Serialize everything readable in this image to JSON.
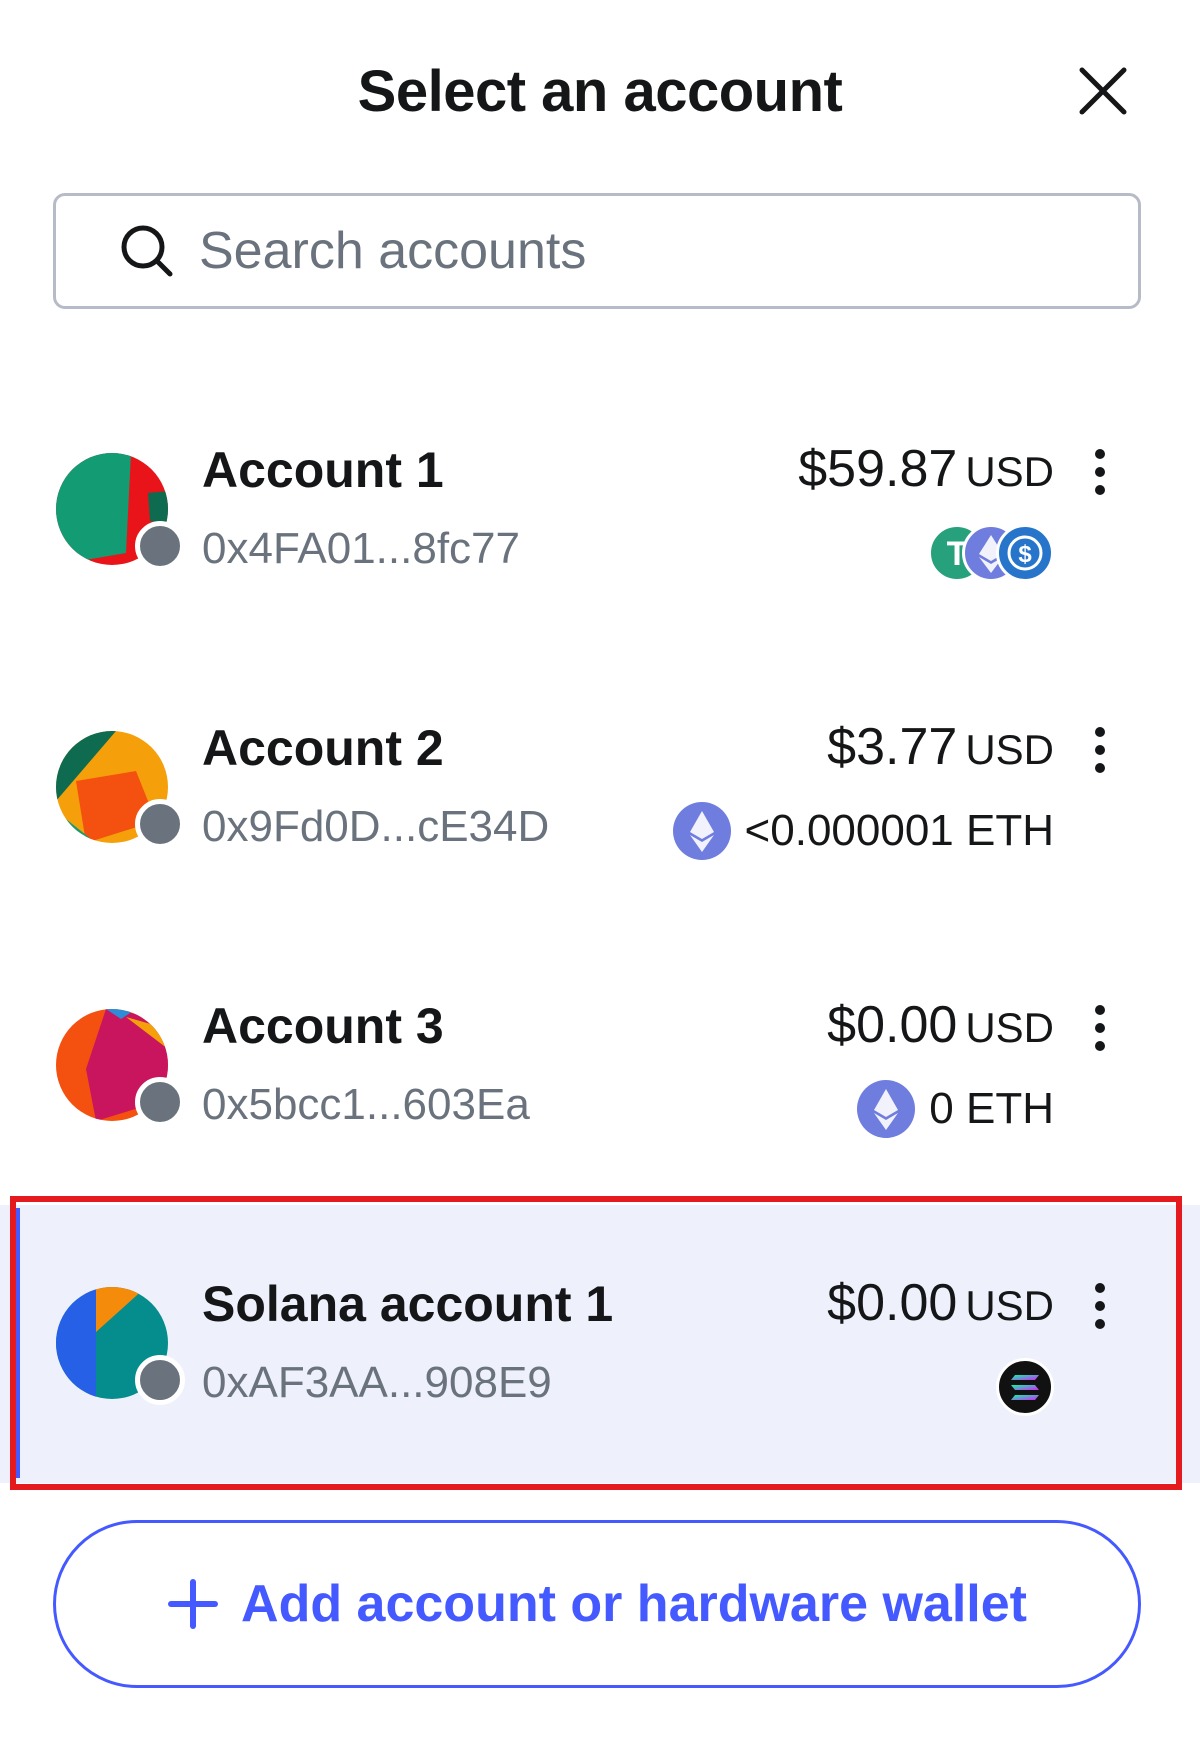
{
  "header": {
    "title": "Select an account",
    "close_icon": "close-icon"
  },
  "search": {
    "placeholder": "Search accounts",
    "icon": "search-icon"
  },
  "accounts": [
    {
      "name": "Account 1",
      "address": "0x4FA01...8fc77",
      "balance": "$59.87",
      "currency": "USD",
      "tokens": [
        "tether-icon",
        "ethereum-icon",
        "usdc-icon"
      ],
      "token_text": "",
      "selected": false
    },
    {
      "name": "Account 2",
      "address": "0x9Fd0D...cE34D",
      "balance": "$3.77",
      "currency": "USD",
      "tokens": [
        "ethereum-icon"
      ],
      "token_text": "<0.000001 ETH",
      "selected": false
    },
    {
      "name": "Account 3",
      "address": "0x5bcc1...603Ea",
      "balance": "$0.00",
      "currency": "USD",
      "tokens": [
        "ethereum-icon"
      ],
      "token_text": "0 ETH",
      "selected": false
    },
    {
      "name": "Solana account 1",
      "address": "0xAF3AA...908E9",
      "balance": "$0.00",
      "currency": "USD",
      "tokens": [
        "solana-icon"
      ],
      "token_text": "",
      "selected": true
    }
  ],
  "add_button": {
    "label": "Add account or hardware wallet",
    "icon": "plus-icon"
  },
  "colors": {
    "accent": "#4459ff",
    "selected_bg": "#eef0fc",
    "highlight_border": "#e51a1e",
    "muted_text": "#6a737d"
  }
}
